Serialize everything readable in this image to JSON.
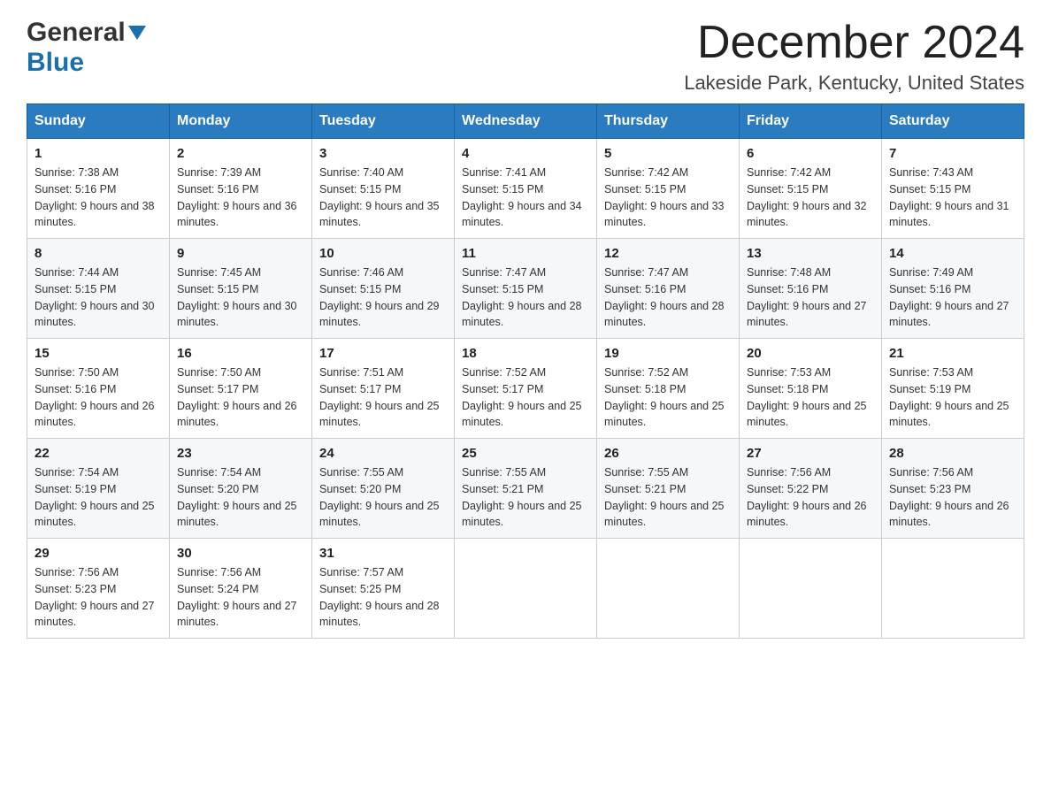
{
  "header": {
    "logo_general": "General",
    "logo_blue": "Blue",
    "month_title": "December 2024",
    "location": "Lakeside Park, Kentucky, United States"
  },
  "days_of_week": [
    "Sunday",
    "Monday",
    "Tuesday",
    "Wednesday",
    "Thursday",
    "Friday",
    "Saturday"
  ],
  "weeks": [
    [
      {
        "day": "1",
        "sunrise": "7:38 AM",
        "sunset": "5:16 PM",
        "daylight": "9 hours and 38 minutes."
      },
      {
        "day": "2",
        "sunrise": "7:39 AM",
        "sunset": "5:16 PM",
        "daylight": "9 hours and 36 minutes."
      },
      {
        "day": "3",
        "sunrise": "7:40 AM",
        "sunset": "5:15 PM",
        "daylight": "9 hours and 35 minutes."
      },
      {
        "day": "4",
        "sunrise": "7:41 AM",
        "sunset": "5:15 PM",
        "daylight": "9 hours and 34 minutes."
      },
      {
        "day": "5",
        "sunrise": "7:42 AM",
        "sunset": "5:15 PM",
        "daylight": "9 hours and 33 minutes."
      },
      {
        "day": "6",
        "sunrise": "7:42 AM",
        "sunset": "5:15 PM",
        "daylight": "9 hours and 32 minutes."
      },
      {
        "day": "7",
        "sunrise": "7:43 AM",
        "sunset": "5:15 PM",
        "daylight": "9 hours and 31 minutes."
      }
    ],
    [
      {
        "day": "8",
        "sunrise": "7:44 AM",
        "sunset": "5:15 PM",
        "daylight": "9 hours and 30 minutes."
      },
      {
        "day": "9",
        "sunrise": "7:45 AM",
        "sunset": "5:15 PM",
        "daylight": "9 hours and 30 minutes."
      },
      {
        "day": "10",
        "sunrise": "7:46 AM",
        "sunset": "5:15 PM",
        "daylight": "9 hours and 29 minutes."
      },
      {
        "day": "11",
        "sunrise": "7:47 AM",
        "sunset": "5:15 PM",
        "daylight": "9 hours and 28 minutes."
      },
      {
        "day": "12",
        "sunrise": "7:47 AM",
        "sunset": "5:16 PM",
        "daylight": "9 hours and 28 minutes."
      },
      {
        "day": "13",
        "sunrise": "7:48 AM",
        "sunset": "5:16 PM",
        "daylight": "9 hours and 27 minutes."
      },
      {
        "day": "14",
        "sunrise": "7:49 AM",
        "sunset": "5:16 PM",
        "daylight": "9 hours and 27 minutes."
      }
    ],
    [
      {
        "day": "15",
        "sunrise": "7:50 AM",
        "sunset": "5:16 PM",
        "daylight": "9 hours and 26 minutes."
      },
      {
        "day": "16",
        "sunrise": "7:50 AM",
        "sunset": "5:17 PM",
        "daylight": "9 hours and 26 minutes."
      },
      {
        "day": "17",
        "sunrise": "7:51 AM",
        "sunset": "5:17 PM",
        "daylight": "9 hours and 25 minutes."
      },
      {
        "day": "18",
        "sunrise": "7:52 AM",
        "sunset": "5:17 PM",
        "daylight": "9 hours and 25 minutes."
      },
      {
        "day": "19",
        "sunrise": "7:52 AM",
        "sunset": "5:18 PM",
        "daylight": "9 hours and 25 minutes."
      },
      {
        "day": "20",
        "sunrise": "7:53 AM",
        "sunset": "5:18 PM",
        "daylight": "9 hours and 25 minutes."
      },
      {
        "day": "21",
        "sunrise": "7:53 AM",
        "sunset": "5:19 PM",
        "daylight": "9 hours and 25 minutes."
      }
    ],
    [
      {
        "day": "22",
        "sunrise": "7:54 AM",
        "sunset": "5:19 PM",
        "daylight": "9 hours and 25 minutes."
      },
      {
        "day": "23",
        "sunrise": "7:54 AM",
        "sunset": "5:20 PM",
        "daylight": "9 hours and 25 minutes."
      },
      {
        "day": "24",
        "sunrise": "7:55 AM",
        "sunset": "5:20 PM",
        "daylight": "9 hours and 25 minutes."
      },
      {
        "day": "25",
        "sunrise": "7:55 AM",
        "sunset": "5:21 PM",
        "daylight": "9 hours and 25 minutes."
      },
      {
        "day": "26",
        "sunrise": "7:55 AM",
        "sunset": "5:21 PM",
        "daylight": "9 hours and 25 minutes."
      },
      {
        "day": "27",
        "sunrise": "7:56 AM",
        "sunset": "5:22 PM",
        "daylight": "9 hours and 26 minutes."
      },
      {
        "day": "28",
        "sunrise": "7:56 AM",
        "sunset": "5:23 PM",
        "daylight": "9 hours and 26 minutes."
      }
    ],
    [
      {
        "day": "29",
        "sunrise": "7:56 AM",
        "sunset": "5:23 PM",
        "daylight": "9 hours and 27 minutes."
      },
      {
        "day": "30",
        "sunrise": "7:56 AM",
        "sunset": "5:24 PM",
        "daylight": "9 hours and 27 minutes."
      },
      {
        "day": "31",
        "sunrise": "7:57 AM",
        "sunset": "5:25 PM",
        "daylight": "9 hours and 28 minutes."
      },
      null,
      null,
      null,
      null
    ]
  ]
}
